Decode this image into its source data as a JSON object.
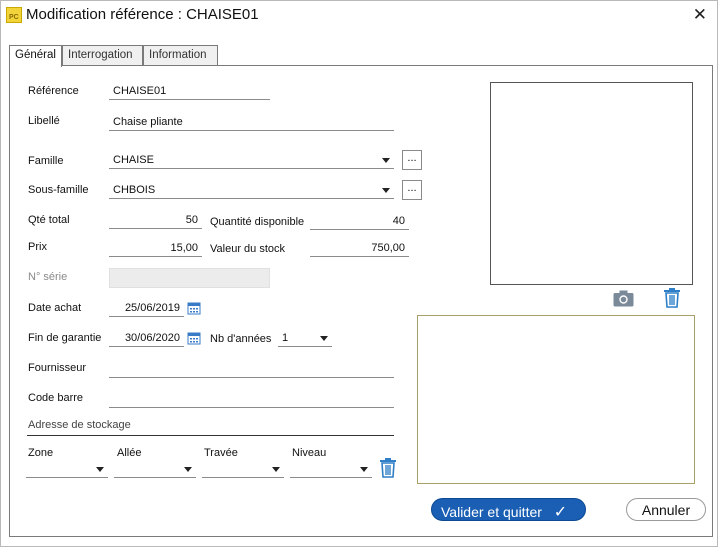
{
  "window": {
    "title": "Modification référence : CHAISE01",
    "app_icon_text": "PC",
    "close_glyph": "✕"
  },
  "tabs": [
    {
      "label": "Général",
      "active": true
    },
    {
      "label": "Interrogation",
      "active": false
    },
    {
      "label": "Information",
      "active": false
    }
  ],
  "form": {
    "reference": {
      "label": "Référence",
      "value": "CHAISE01"
    },
    "libelle": {
      "label": "Libellé",
      "value": "Chaise pliante"
    },
    "famille": {
      "label": "Famille",
      "value": "CHAISE",
      "button": "..."
    },
    "sous_famille": {
      "label": "Sous-famille",
      "value": "CHBOIS",
      "button": "..."
    },
    "qte_total": {
      "label": "Qté total",
      "value": "50"
    },
    "quantite_disponible": {
      "label": "Quantité disponible",
      "value": "40"
    },
    "prix": {
      "label": "Prix",
      "value": "15,00"
    },
    "valeur_stock": {
      "label": "Valeur du stock",
      "value": "750,00"
    },
    "numero_serie": {
      "label": "N° série",
      "value": ""
    },
    "date_achat": {
      "label": "Date achat",
      "value": "25/06/2019"
    },
    "fin_garantie": {
      "label": "Fin de garantie",
      "value": "30/06/2020"
    },
    "nb_annees": {
      "label": "Nb d'années",
      "value": "1"
    },
    "fournisseur": {
      "label": "Fournisseur",
      "value": ""
    },
    "code_barre": {
      "label": "Code barre",
      "value": ""
    }
  },
  "stockage": {
    "section_label": "Adresse de stockage",
    "zone": {
      "label": "Zone",
      "value": ""
    },
    "allee": {
      "label": "Allée",
      "value": ""
    },
    "travee": {
      "label": "Travée",
      "value": ""
    },
    "niveau": {
      "label": "Niveau",
      "value": ""
    }
  },
  "buttons": {
    "validate": "Valider et quitter",
    "validate_check": "✓",
    "cancel": "Annuler"
  },
  "colors": {
    "primary": "#1a5fb4",
    "icon_blue": "#2f7fc8",
    "memo_border": "#a8a06a"
  }
}
